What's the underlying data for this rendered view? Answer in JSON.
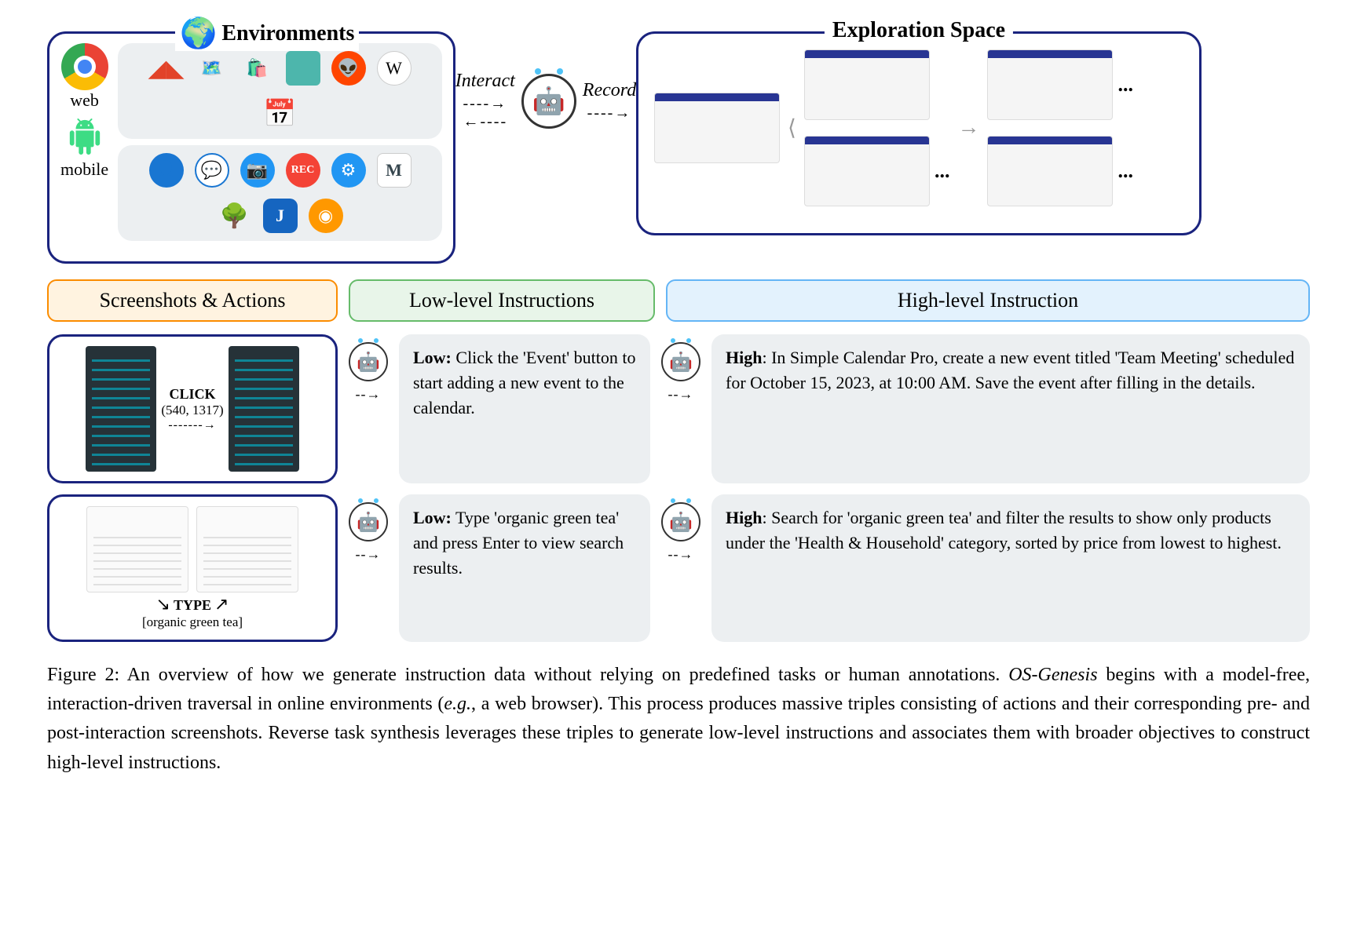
{
  "environments": {
    "title": "Environments",
    "left": [
      {
        "label": "web"
      },
      {
        "label": "mobile"
      }
    ],
    "row1_icons": [
      "gitlab-icon",
      "maps-icon",
      "shopping-icon",
      "chat-icon"
    ],
    "row2_icons": [
      "reddit-icon",
      "wikipedia-icon",
      "calendar-icon"
    ],
    "row3_icons": [
      "contacts-icon",
      "messages-icon",
      "camera-icon",
      "recorder-icon",
      "settings-icon"
    ],
    "row4_icons": [
      "markor-icon",
      "tree-icon",
      "joplin-icon",
      "osmand-icon"
    ]
  },
  "middle": {
    "interact": "Interact",
    "record": "Record"
  },
  "exploration": {
    "title": "Exploration Space",
    "ellipsis": "..."
  },
  "sections": {
    "s1": "Screenshots & Actions",
    "s2": "Low-level Instructions",
    "s3": "High-level Instruction"
  },
  "examples": [
    {
      "action_name": "CLICK",
      "action_args": "(540, 1317)",
      "low_label": "Low:",
      "low_text": " Click the 'Event' button to start adding a new event to the calendar.",
      "high_label": "High",
      "high_text": ": In Simple Calendar Pro, create a new event titled 'Team Meeting' scheduled for October 15, 2023, at 10:00 AM. Save the event after filling in the details."
    },
    {
      "action_name": "TYPE",
      "action_args": "[organic green tea]",
      "low_label": "Low:",
      "low_text": " Type 'organic green tea' and press Enter to view search results.",
      "high_label": "High",
      "high_text": ": Search for 'organic green tea' and filter the results to show only products under the 'Health & Household' category, sorted by price from lowest to highest."
    }
  ],
  "caption": {
    "fig": "Figure 2:",
    "pre": " An overview of how we generate instruction data without relying on predefined tasks or human annotations. ",
    "ital": "OS-Genesis",
    "mid": " begins with a model-free, interaction-driven traversal in online environments (",
    "eg": "e.g.",
    "post": ", a web browser). This process produces massive triples consisting of actions and their corresponding pre- and post-interaction screenshots. Reverse task synthesis leverages these triples to generate low-level instructions and associates them with broader objectives to construct high-level instructions."
  }
}
